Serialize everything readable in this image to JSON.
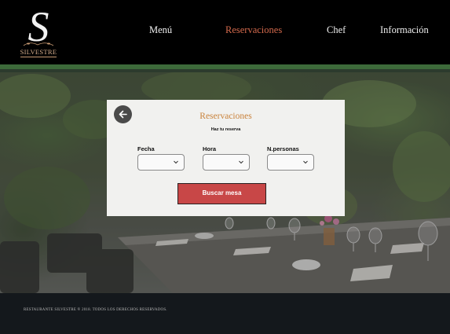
{
  "brand": {
    "logo_letter": "S",
    "logo_name": "SILVESTRE"
  },
  "nav": {
    "items": [
      {
        "label": "Menú"
      },
      {
        "label": "Reservaciones"
      },
      {
        "label": "Chef"
      },
      {
        "label": "Información"
      }
    ],
    "active_index": 1,
    "active_color": "#d2694c"
  },
  "reservation": {
    "title": "Reservaciones",
    "subtitle": "Haz tu reserva",
    "back_icon": "arrow-left-icon",
    "fields": [
      {
        "label": "Fecha",
        "value": ""
      },
      {
        "label": "Hora",
        "value": ""
      },
      {
        "label": "N.personas",
        "value": ""
      }
    ],
    "submit_label": "Buscar mesa",
    "submit_color": "#c84747"
  },
  "footer": {
    "copyright": "RESTAURANTE SILVESTRE ® 2018. TODOS LOS DERECHOS RESERVADOS."
  }
}
